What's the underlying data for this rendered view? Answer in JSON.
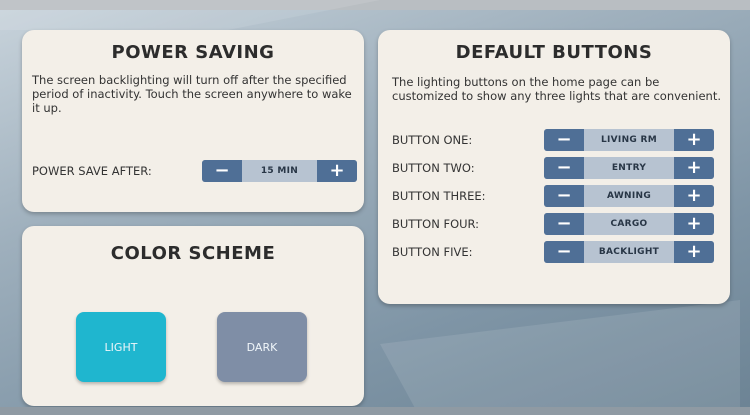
{
  "power_saving": {
    "title": "POWER SAVING",
    "description": "The screen backlighting will turn off after the specified period of inactivity. Touch the screen anywhere to wake it up.",
    "label": "POWER SAVE AFTER:",
    "value": "15 MIN",
    "minus": "−",
    "plus": "+"
  },
  "color_scheme": {
    "title": "COLOR SCHEME",
    "light_label": "LIGHT",
    "dark_label": "DARK",
    "selected": "LIGHT",
    "light_color": "#1fb6cf",
    "dark_color": "#7f8ea6"
  },
  "default_buttons": {
    "title": "DEFAULT BUTTONS",
    "description": "The lighting buttons on the home page can be customized to show any three lights that are convenient.",
    "minus": "−",
    "plus": "+",
    "rows": [
      {
        "label": "BUTTON ONE:",
        "value": "LIVING RM"
      },
      {
        "label": "BUTTON TWO:",
        "value": "ENTRY"
      },
      {
        "label": "BUTTON THREE:",
        "value": "AWNING"
      },
      {
        "label": "BUTTON FOUR:",
        "value": "CARGO"
      },
      {
        "label": "BUTTON FIVE:",
        "value": "BACKLIGHT"
      }
    ]
  },
  "colors": {
    "panel_bg": "#f3efe8",
    "stepper_button": "#4f6f96",
    "stepper_value_bg": "#b7c3d1"
  }
}
